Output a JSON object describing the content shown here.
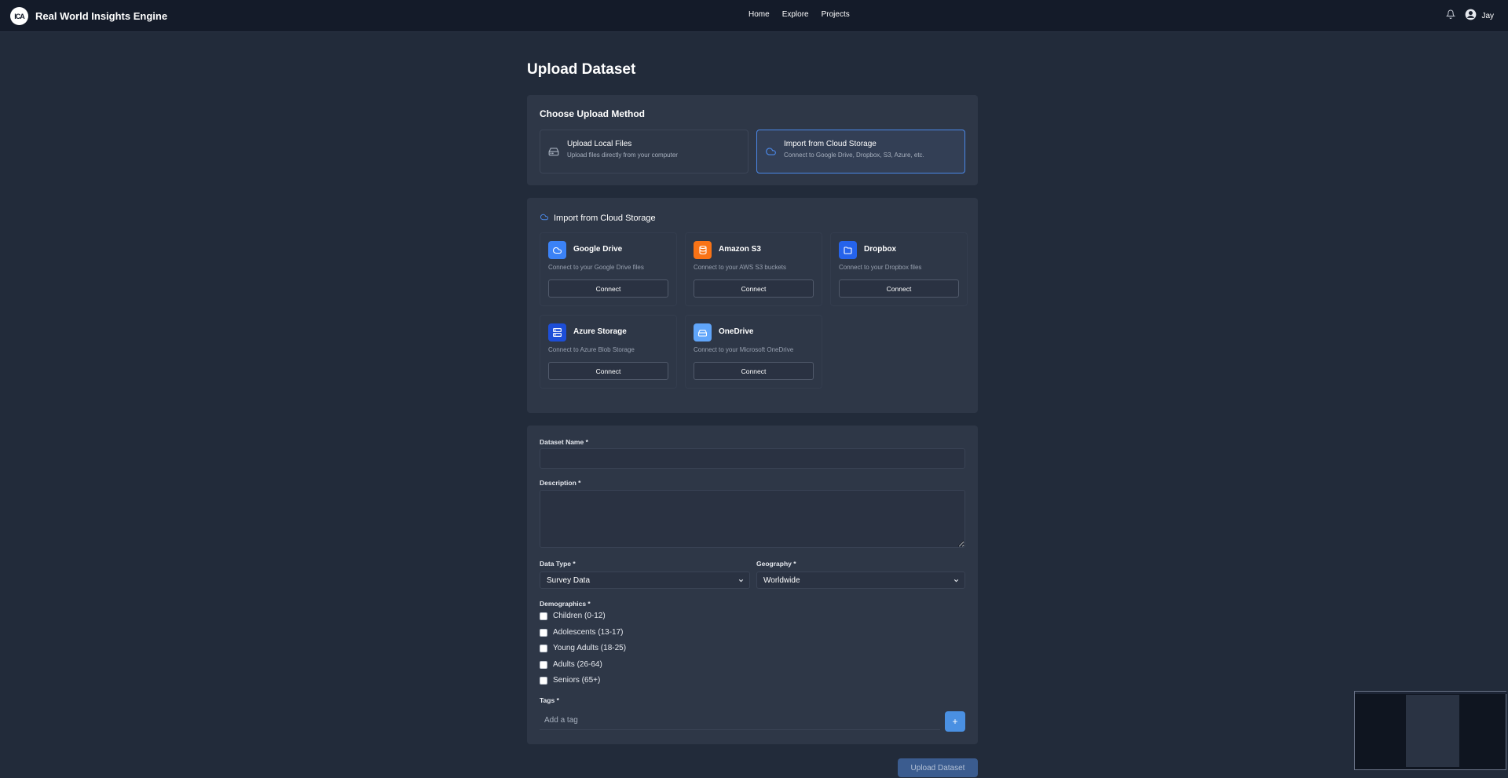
{
  "header": {
    "logo_text": "ICA",
    "brand": "Real World Insights Engine",
    "nav": [
      "Home",
      "Explore",
      "Projects"
    ],
    "user_name": "Jay"
  },
  "page": {
    "title": "Upload Dataset"
  },
  "upload_method": {
    "title": "Choose Upload Method",
    "options": [
      {
        "title": "Upload Local Files",
        "subtitle": "Upload files directly from your computer",
        "selected": false
      },
      {
        "title": "Import from Cloud Storage",
        "subtitle": "Connect to Google Drive, Dropbox, S3, Azure, etc.",
        "selected": true
      }
    ]
  },
  "cloud": {
    "title": "Import from Cloud Storage",
    "providers": [
      {
        "name": "Google Drive",
        "description": "Connect to your Google Drive files",
        "button": "Connect",
        "icon": "cloud-icon",
        "color": "#3b82f6"
      },
      {
        "name": "Amazon S3",
        "description": "Connect to your AWS S3 buckets",
        "button": "Connect",
        "icon": "database-icon",
        "color": "#f97316"
      },
      {
        "name": "Dropbox",
        "description": "Connect to your Dropbox files",
        "button": "Connect",
        "icon": "folder-icon",
        "color": "#2563eb"
      },
      {
        "name": "Azure Storage",
        "description": "Connect to Azure Blob Storage",
        "button": "Connect",
        "icon": "server-icon",
        "color": "#1d4ed8"
      },
      {
        "name": "OneDrive",
        "description": "Connect to your Microsoft OneDrive",
        "button": "Connect",
        "icon": "drive-icon",
        "color": "#60a5fa"
      }
    ]
  },
  "form": {
    "dataset_name_label": "Dataset Name *",
    "dataset_name_value": "",
    "description_label": "Description *",
    "description_value": "",
    "data_type_label": "Data Type *",
    "data_type_value": "Survey Data",
    "geography_label": "Geography *",
    "geography_value": "Worldwide",
    "demographics_label": "Demographics *",
    "demographics": [
      {
        "label": "Children (0-12)",
        "checked": false
      },
      {
        "label": "Adolescents (13-17)",
        "checked": false
      },
      {
        "label": "Young Adults (18-25)",
        "checked": false
      },
      {
        "label": "Adults (26-64)",
        "checked": false
      },
      {
        "label": "Seniors (65+)",
        "checked": false
      }
    ],
    "tags_label": "Tags *",
    "tag_placeholder": "Add a tag",
    "tag_add_symbol": "+"
  },
  "actions": {
    "submit": "Upload Dataset"
  },
  "colors": {
    "accent": "#4b88e8",
    "background": "#222b3a",
    "card": "#2e3747",
    "header": "#141b29"
  }
}
